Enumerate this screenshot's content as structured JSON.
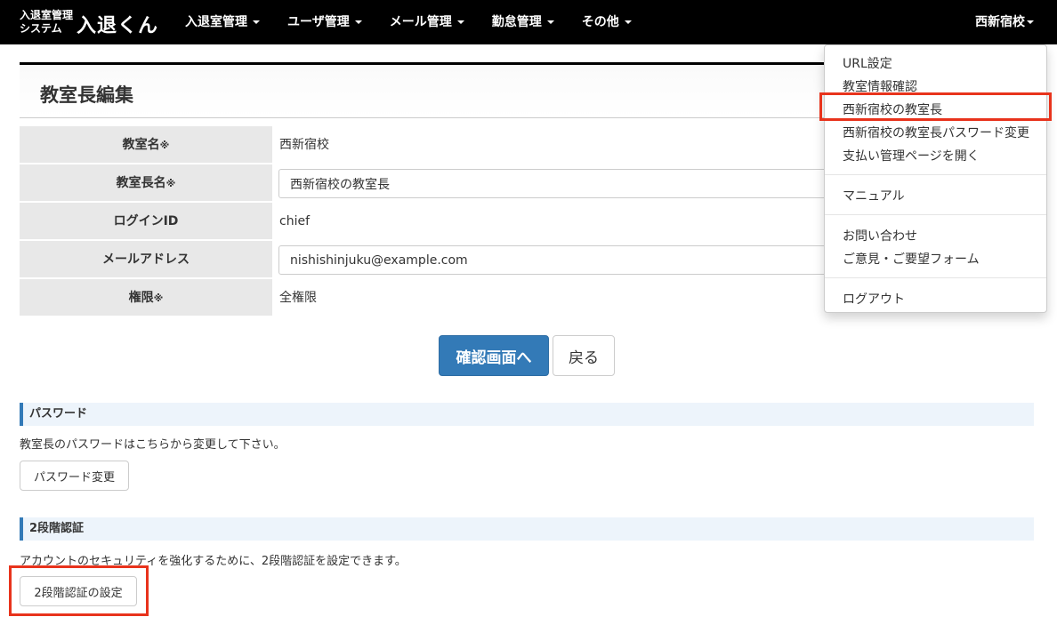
{
  "navbar": {
    "logo_line1": "入退室管理",
    "logo_line2": "システム",
    "logo_name": "入退くん",
    "items": [
      {
        "label": "入退室管理"
      },
      {
        "label": "ユーザ管理"
      },
      {
        "label": "メール管理"
      },
      {
        "label": "勤怠管理"
      },
      {
        "label": "その他"
      }
    ],
    "user_menu": "西新宿校"
  },
  "page": {
    "title": "教室長編集"
  },
  "form": {
    "rows": [
      {
        "label": "教室名",
        "required": "※",
        "value": "西新宿校"
      },
      {
        "label": "教室長名",
        "required": "※",
        "value": "西新宿校の教室長"
      },
      {
        "label": "ログインID",
        "required": "",
        "value": "chief"
      },
      {
        "label": "メールアドレス",
        "required": "",
        "value": "nishishinjuku@example.com"
      },
      {
        "label": "権限",
        "required": "※",
        "value": "全権限"
      }
    ],
    "confirm_label": "確認画面へ",
    "back_label": "戻る"
  },
  "password_section": {
    "heading": "パスワード",
    "text": "教室長のパスワードはこちらから変更して下さい。",
    "button": "パスワード変更"
  },
  "twofactor_section": {
    "heading": "2段階認証",
    "text": "アカウントのセキュリティを強化するために、2段階認証を設定できます。",
    "button": "2段階認証の設定"
  },
  "dropdown": {
    "items": [
      {
        "label": "URL設定"
      },
      {
        "label": "教室情報確認"
      },
      {
        "label": "西新宿校の教室長"
      },
      {
        "label": "西新宿校の教室長パスワード変更"
      },
      {
        "label": "支払い管理ページを開く"
      },
      {
        "label": "マニュアル"
      },
      {
        "label": "お問い合わせ"
      },
      {
        "label": "ご意見・ご要望フォーム"
      },
      {
        "label": "ログアウト"
      }
    ]
  },
  "colors": {
    "highlight": "#e8331c",
    "primary": "#337ab7"
  }
}
